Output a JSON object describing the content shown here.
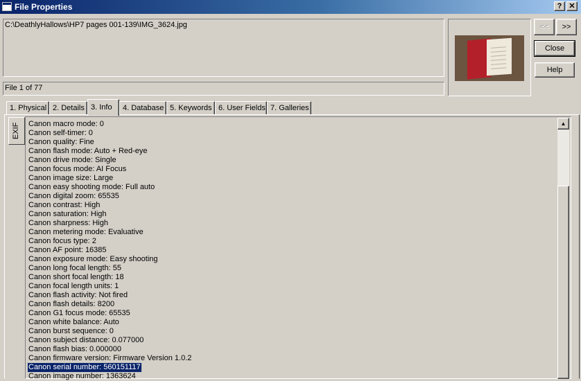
{
  "window": {
    "title": "File Properties",
    "help_glyph": "?",
    "close_glyph": "✕"
  },
  "file": {
    "path": "C:\\DeathlyHallows\\HP7 pages 001-139\\IMG_3624.jpg",
    "status": "File 1 of 77"
  },
  "nav": {
    "prev_label": "<<",
    "next_label": ">>"
  },
  "buttons": {
    "close_label": "Close",
    "help_label": "Help"
  },
  "tabs": [
    {
      "label": "1. Physical"
    },
    {
      "label": "2. Details"
    },
    {
      "label": "3. Info",
      "active": true
    },
    {
      "label": "4. Database"
    },
    {
      "label": "5. Keywords"
    },
    {
      "label": "6. User Fields"
    },
    {
      "label": "7. Galleries"
    }
  ],
  "side_tab": {
    "label": "EXIF"
  },
  "exif_rows": [
    "Canon macro mode: 0",
    "Canon self-timer: 0",
    "Canon quality: Fine",
    "Canon flash mode: Auto + Red-eye",
    "Canon drive mode: Single",
    "Canon focus mode: AI Focus",
    "Canon image size: Large",
    "Canon easy shooting mode: Full auto",
    "Canon digital zoom: 65535",
    "Canon contrast: High",
    "Canon saturation: High",
    "Canon sharpness: High",
    "Canon metering mode: Evaluative",
    "Canon focus type: 2",
    "Canon AF point: 16385",
    "Canon exposure mode: Easy shooting",
    "Canon long focal length: 55",
    "Canon short focal length: 18",
    "Canon focal length units: 1",
    "Canon flash activity: Not fired",
    "Canon flash details: 8200",
    "Canon G1 focus mode: 65535",
    "Canon white balance: Auto",
    "Canon burst sequence: 0",
    "Canon subject distance: 0.077000",
    "Canon flash bias: 0.000000",
    "Canon firmware version: Firmware Version 1.0.2",
    "Canon serial number: 560151117",
    "Canon image number: 1363624"
  ],
  "selected_row": 27,
  "scrollbar": {
    "up_glyph": "▲"
  },
  "colors": {
    "selection": "#0a246a",
    "title_start": "#0a246a",
    "title_end": "#a6caf0"
  }
}
